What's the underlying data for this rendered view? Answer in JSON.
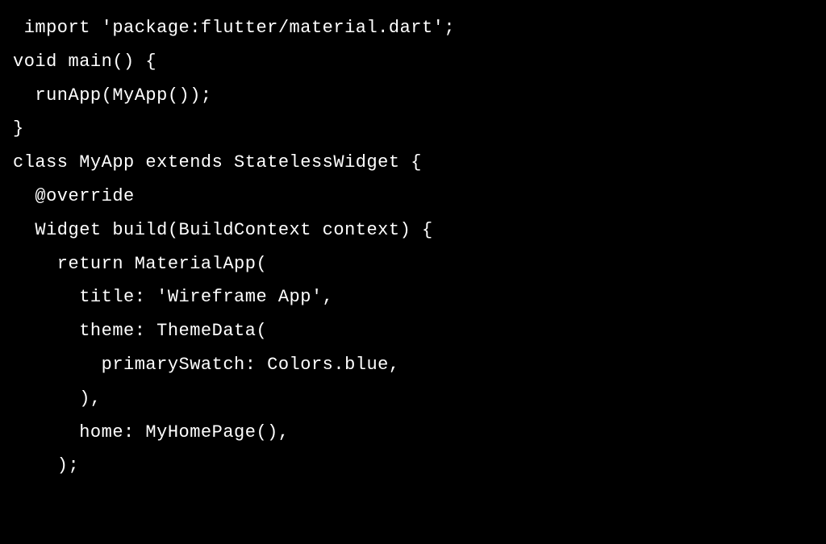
{
  "code": {
    "lines": [
      " import 'package:flutter/material.dart';",
      "",
      "void main() {",
      "  runApp(MyApp());",
      "}",
      "",
      "class MyApp extends StatelessWidget {",
      "  @override",
      "  Widget build(BuildContext context) {",
      "    return MaterialApp(",
      "      title: 'Wireframe App',",
      "      theme: ThemeData(",
      "        primarySwatch: Colors.blue,",
      "      ),",
      "      home: MyHomePage(),",
      "    );"
    ]
  }
}
